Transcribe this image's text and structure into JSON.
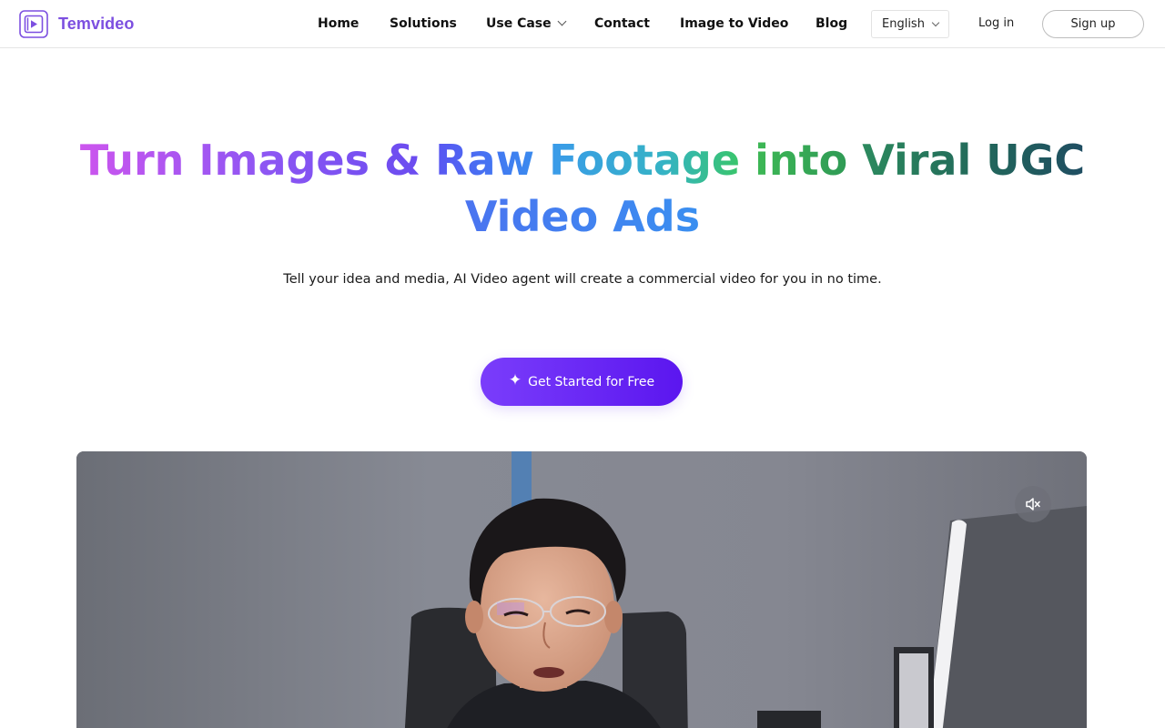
{
  "brand": {
    "name": "Temvideo",
    "color": "#7c4fe0"
  },
  "nav": {
    "items": [
      {
        "label": "Home"
      },
      {
        "label": "Solutions"
      },
      {
        "label": "Use Case",
        "has_dropdown": true
      },
      {
        "label": "Contact"
      },
      {
        "label": "Image to Video"
      },
      {
        "label": "Blog"
      }
    ],
    "language": "English",
    "login": "Log in",
    "signup": "Sign up"
  },
  "hero": {
    "title_parts": [
      "Turn Images &",
      "Raw",
      "Footage",
      "into",
      "Viral UGC",
      "Video Ads"
    ],
    "subtitle": "Tell your idea and media, AI Video agent will create a commercial video for you in no time.",
    "cta": {
      "icon": "sparkle-icon",
      "label": "Get Started for Free",
      "color": "#6a2cf6"
    }
  },
  "video": {
    "mute_icon": "speaker-muted-icon"
  }
}
